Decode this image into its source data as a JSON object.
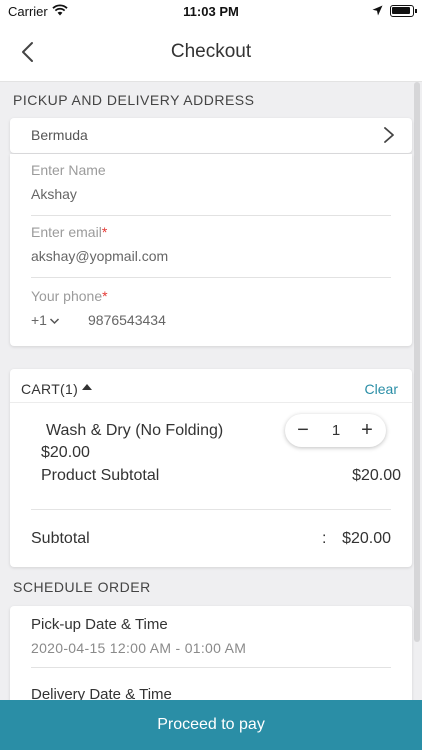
{
  "status_bar": {
    "carrier": "Carrier",
    "time": "11:03 PM"
  },
  "nav": {
    "title": "Checkout"
  },
  "address": {
    "section_title": "PICKUP AND DELIVERY ADDRESS",
    "country": "Bermuda",
    "name_placeholder": "Enter Name",
    "name_value": "Akshay",
    "email_placeholder": "Enter email",
    "email_value": "akshay@yopmail.com",
    "phone_placeholder": "Your phone",
    "required_mark": "*",
    "phone_code": "+1",
    "phone_value": "9876543434"
  },
  "cart": {
    "title": "CART(1)",
    "clear_label": "Clear",
    "items": [
      {
        "name": "Wash & Dry (No Folding)",
        "price": "$20.00",
        "quantity": "1"
      }
    ],
    "product_subtotal_label": "Product Subtotal",
    "product_subtotal_value": "$20.00",
    "subtotal_label": "Subtotal",
    "subtotal_separator": ":",
    "subtotal_value": "$20.00"
  },
  "schedule": {
    "section_title": "SCHEDULE ORDER",
    "pickup_label": "Pick-up Date & Time",
    "pickup_value": "2020-04-15 12:00 AM - 01:00 AM",
    "delivery_label": "Delivery Date & Time"
  },
  "footer": {
    "proceed_label": "Proceed to pay"
  },
  "colors": {
    "accent": "#2a8ea6",
    "required": "#e53935",
    "background": "#efeff1"
  },
  "icons": [
    "wifi-icon",
    "location-arrow-icon",
    "battery-icon",
    "back-chevron-icon",
    "chevron-right-icon",
    "chevron-down-icon",
    "caret-up-icon",
    "minus-icon",
    "plus-icon"
  ]
}
